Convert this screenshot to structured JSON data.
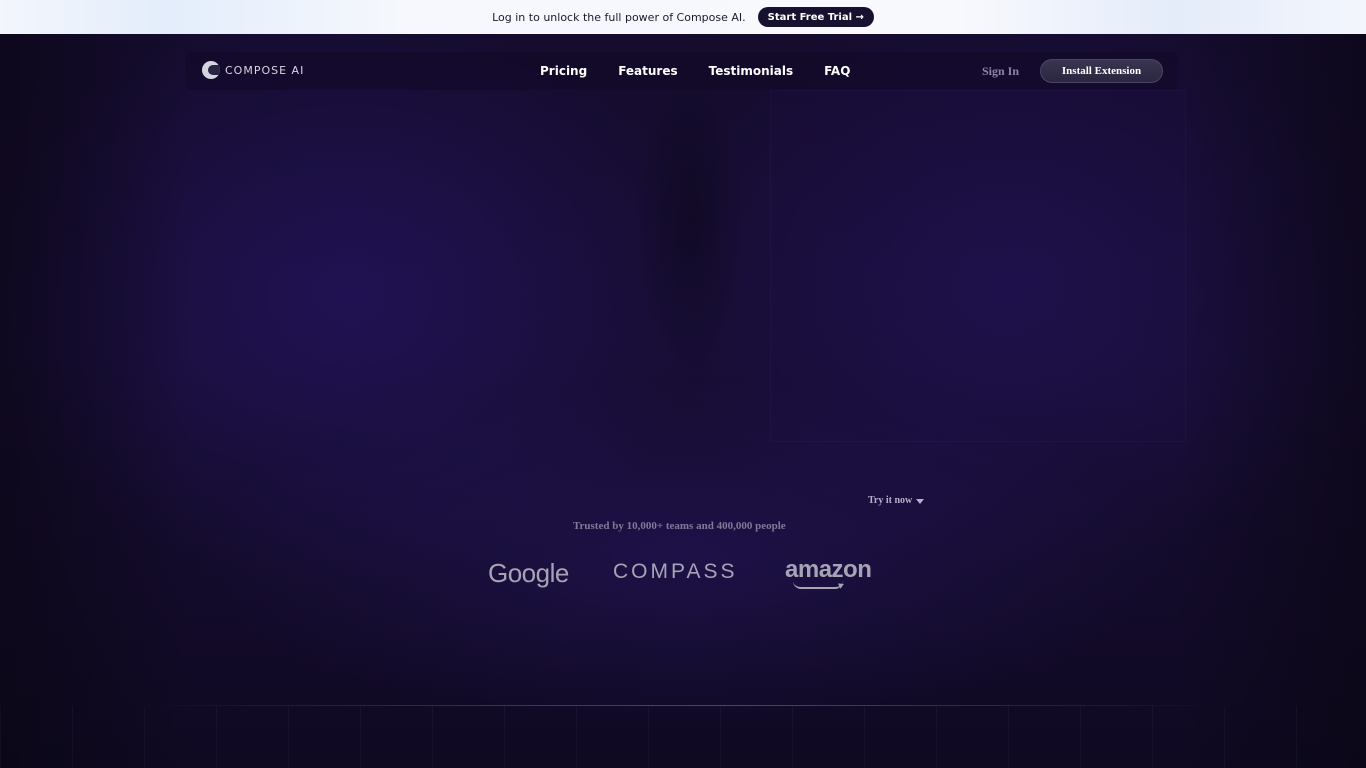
{
  "banner": {
    "message": "Log in to unlock the full power of Compose AI.",
    "cta_label": "Start Free Trial →"
  },
  "header": {
    "logo_text": "COMPOSE AI",
    "nav_links": [
      {
        "label": "Pricing"
      },
      {
        "label": "Features"
      },
      {
        "label": "Testimonials"
      },
      {
        "label": "FAQ"
      }
    ],
    "sign_in_label": "Sign In",
    "install_label": "Install Extension"
  },
  "hero": {
    "try_label": "Try it now"
  },
  "trust": {
    "text": "Trusted by 10,000+ teams and 400,000 people",
    "logos": [
      "Google",
      "COMPASS",
      "amazon"
    ]
  },
  "colors": {
    "background": "#150c2e",
    "banner_button": "#17112f"
  }
}
